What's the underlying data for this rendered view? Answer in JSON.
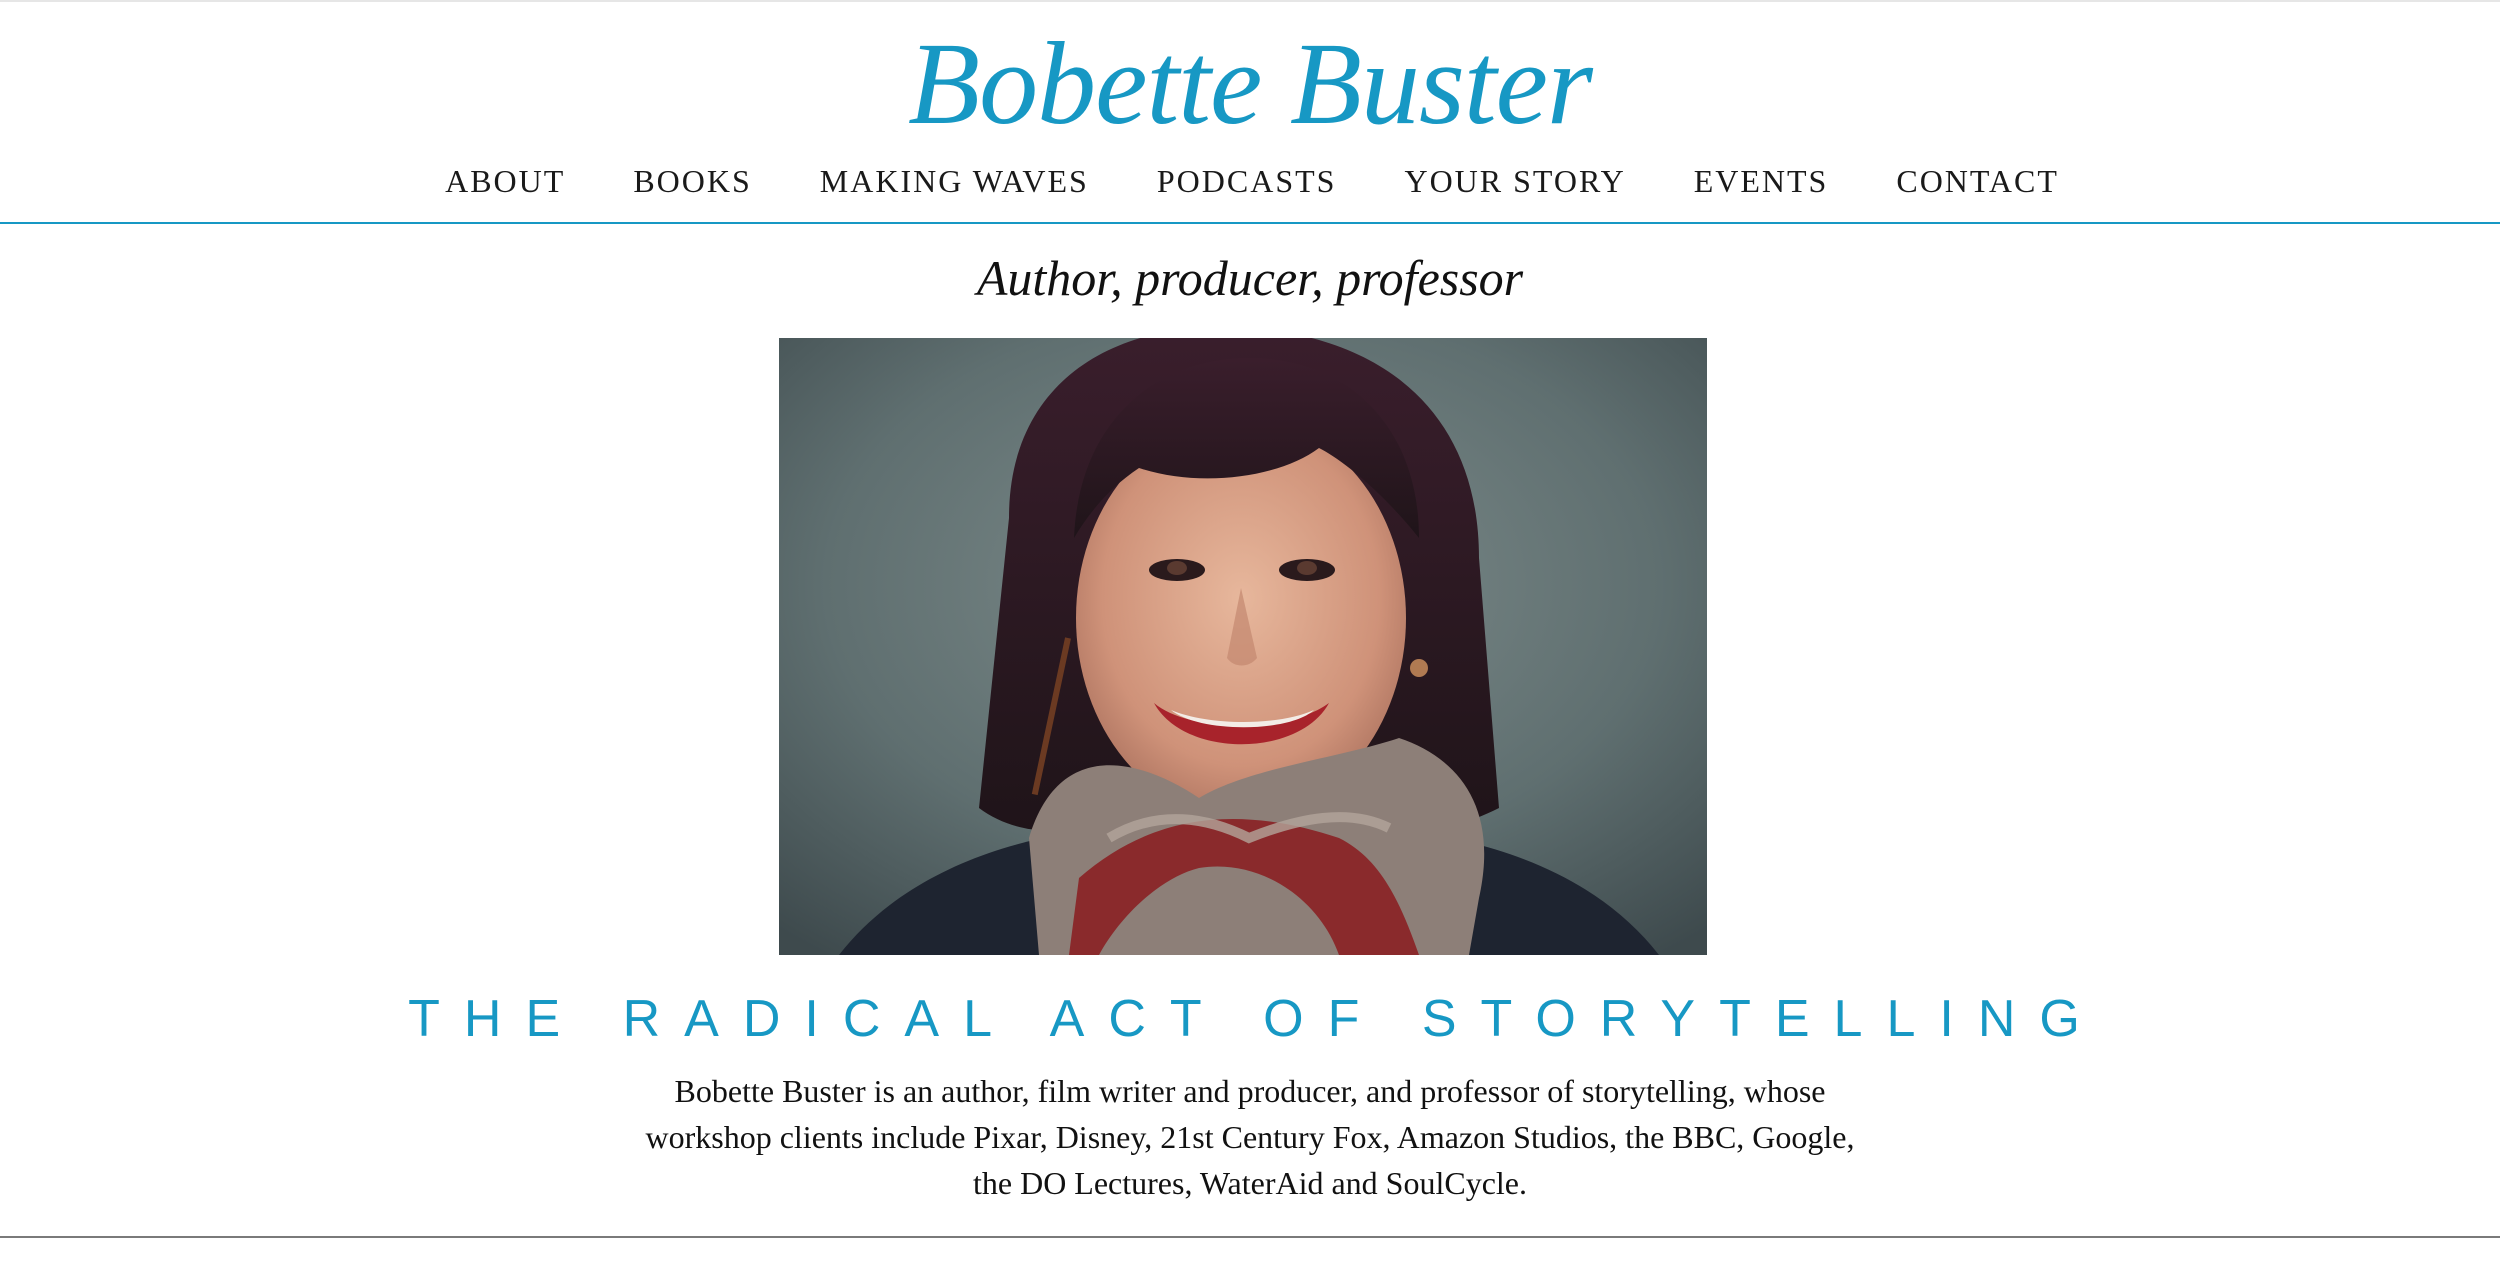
{
  "site": {
    "title": "Bobette Buster"
  },
  "nav": {
    "items": [
      {
        "label": "ABOUT"
      },
      {
        "label": "BOOKS"
      },
      {
        "label": "MAKING WAVES"
      },
      {
        "label": "PODCASTS"
      },
      {
        "label": "YOUR STORY"
      },
      {
        "label": "EVENTS"
      },
      {
        "label": "CONTACT"
      }
    ]
  },
  "hero": {
    "tagline": "Author, producer, professor",
    "image_description": "portrait photo"
  },
  "intro": {
    "heading": "THE RADICAL ACT OF STORYTELLING",
    "bio_line_1": "Bobette Buster is an author, film writer and producer, and professor of storytelling, whose",
    "bio_line_2": "workshop clients include Pixar, Disney, 21st Century Fox, Amazon Studios, the BBC, Google,",
    "bio_line_3": "the DO Lectures, WaterAid and SoulCycle."
  },
  "colors": {
    "accent": "#1798c4",
    "text": "#1a1a1a",
    "background": "#ffffff"
  }
}
